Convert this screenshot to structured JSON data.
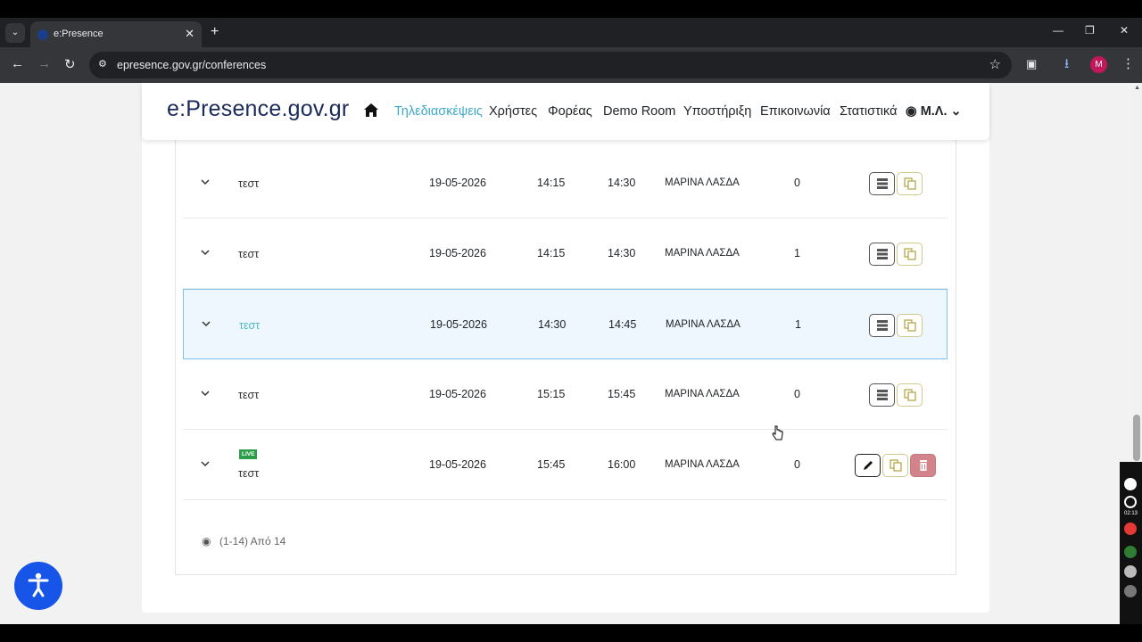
{
  "browser": {
    "tab_title": "e:Presence",
    "url": "epresence.gov.gr/conferences",
    "avatar_letter": "M"
  },
  "site": {
    "logo": "e:Presence.gov.gr",
    "nav": {
      "conferences": "Τηλεδιασκέψεις",
      "users": "Χρήστες",
      "organizations": "Φορέας",
      "demo_room": "Demo Room",
      "support": "Υποστήριξη",
      "contact": "Επικοινωνία",
      "statistics": "Στατιστικά",
      "user": "Μ.Λ."
    },
    "active_color": "#3aa8c9"
  },
  "rows": [
    {
      "name": "τεστ",
      "date": "19-05-2026",
      "start": "14:15",
      "end": "14:30",
      "owner": "ΜΑΡΙΝΑ ΛΑΣΔΑ",
      "count": "0"
    },
    {
      "name": "τεστ",
      "date": "19-05-2026",
      "start": "14:15",
      "end": "14:30",
      "owner": "ΜΑΡΙΝΑ ΛΑΣΔΑ",
      "count": "1"
    },
    {
      "name": "τεστ",
      "date": "19-05-2026",
      "start": "14:30",
      "end": "14:45",
      "owner": "ΜΑΡΙΝΑ ΛΑΣΔΑ",
      "count": "1"
    },
    {
      "name": "τεστ",
      "date": "19-05-2026",
      "start": "15:15",
      "end": "15:45",
      "owner": "ΜΑΡΙΝΑ ΛΑΣΔΑ",
      "count": "0"
    },
    {
      "name": "τεστ",
      "badge": "LIVE",
      "date": "19-05-2026",
      "start": "15:45",
      "end": "16:00",
      "owner": "ΜΑΡΙΝΑ ΛΑΣΔΑ",
      "count": "0"
    }
  ],
  "pagination": {
    "summary": "(1-14) Από 14"
  },
  "recorder": {
    "time": "02:13"
  }
}
